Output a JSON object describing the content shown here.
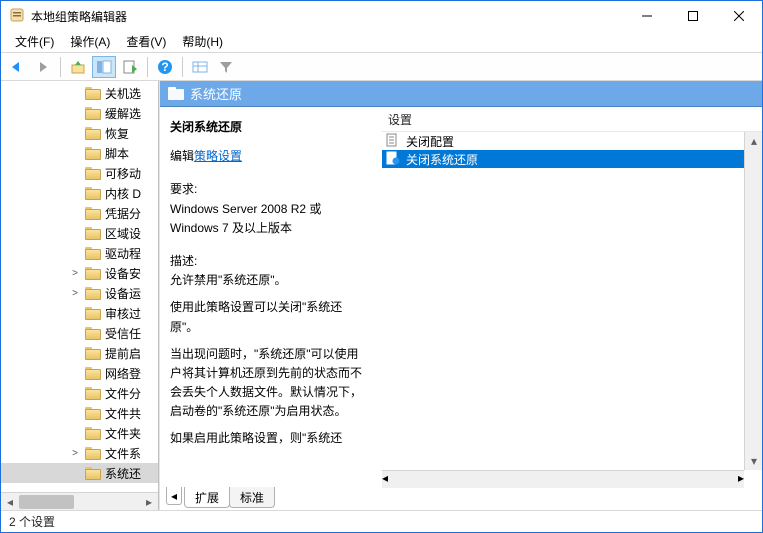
{
  "title": "本地组策略编辑器",
  "menus": {
    "file": "文件(F)",
    "action": "操作(A)",
    "view": "查看(V)",
    "help": "帮助(H)"
  },
  "tree": [
    {
      "label": "关机选",
      "expander": ""
    },
    {
      "label": "缓解选",
      "expander": ""
    },
    {
      "label": "恢复",
      "expander": ""
    },
    {
      "label": "脚本",
      "expander": ""
    },
    {
      "label": "可移动",
      "expander": ""
    },
    {
      "label": "内核 D",
      "expander": ""
    },
    {
      "label": "凭据分",
      "expander": ""
    },
    {
      "label": "区域设",
      "expander": ""
    },
    {
      "label": "驱动程",
      "expander": ""
    },
    {
      "label": "设备安",
      "expander": ">"
    },
    {
      "label": "设备运",
      "expander": ">"
    },
    {
      "label": "审核过",
      "expander": ""
    },
    {
      "label": "受信任",
      "expander": ""
    },
    {
      "label": "提前启",
      "expander": ""
    },
    {
      "label": "网络登",
      "expander": ""
    },
    {
      "label": "文件分",
      "expander": ""
    },
    {
      "label": "文件共",
      "expander": ""
    },
    {
      "label": "文件夹",
      "expander": ""
    },
    {
      "label": "文件系",
      "expander": ">"
    },
    {
      "label": "系统还",
      "expander": "",
      "selected": true
    }
  ],
  "detail": {
    "header": "系统还原",
    "title": "关闭系统还原",
    "edit_prefix": "编辑",
    "edit_link": "策略设置",
    "req_label": "要求:",
    "req_text": "Windows Server 2008 R2 或 Windows 7 及以上版本",
    "desc_label": "描述:",
    "desc_text": "允许禁用\"系统还原\"。",
    "p1": "使用此策略设置可以关闭\"系统还原\"。",
    "p2": "当出现问题时，\"系统还原\"可以使用户将其计算机还原到先前的状态而不会丢失个人数据文件。默认情况下，启动卷的\"系统还原\"为启用状态。",
    "p3": "如果启用此策略设置，则\"系统还"
  },
  "list": {
    "column": "设置",
    "items": [
      {
        "label": "关闭配置",
        "icon": "policy-unset",
        "selected": false
      },
      {
        "label": "关闭系统还原",
        "icon": "policy-set",
        "selected": true
      }
    ]
  },
  "tabs": {
    "extended": "扩展",
    "standard": "标准"
  },
  "status": "2 个设置"
}
